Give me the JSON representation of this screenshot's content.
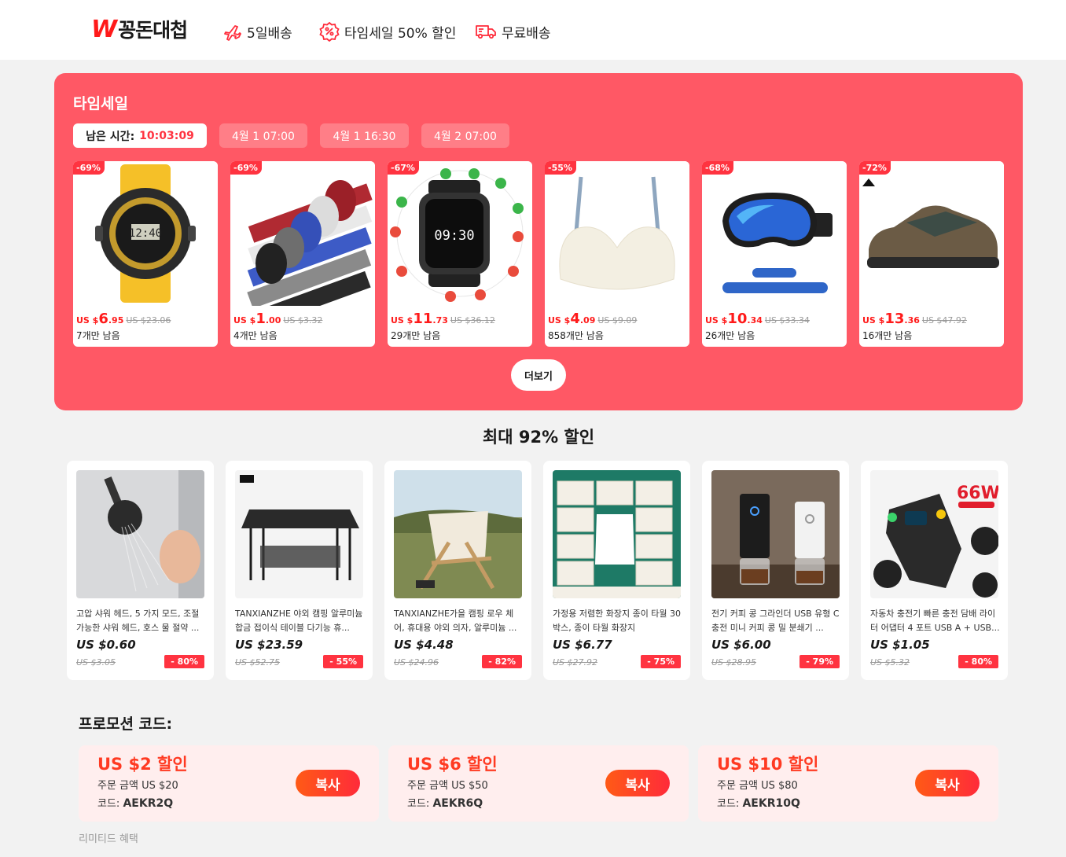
{
  "header": {
    "logo_mark": "W",
    "logo_text": "꽁돈대첩",
    "items": [
      {
        "label": "5일배송",
        "icon": "airplane-icon"
      },
      {
        "label": "타임세일 50% 할인",
        "icon": "discount-icon"
      },
      {
        "label": "무료배송",
        "icon": "truck-icon"
      }
    ]
  },
  "timesale": {
    "title": "타임세일",
    "remaining_label": "남은 시간:",
    "countdown": "10:03:09",
    "tabs": [
      "4월 1 07:00",
      "4월 1 16:30",
      "4월 2 07:00"
    ],
    "more_label": "더보기",
    "products": [
      {
        "discount": "-69%",
        "currency": "US $",
        "int": "6",
        "dec": ".95",
        "orig": "US $23.06",
        "left": "7개만 남음",
        "image": "watch"
      },
      {
        "discount": "-69%",
        "currency": "US $",
        "int": "1",
        "dec": ".00",
        "orig": "US $3.32",
        "left": "4개만 남음",
        "image": "velcro-ties"
      },
      {
        "discount": "-67%",
        "currency": "US $",
        "int": "11",
        "dec": ".73",
        "orig": "US $36.12",
        "left": "29개만 남음",
        "image": "smartwatch"
      },
      {
        "discount": "-55%",
        "currency": "US $",
        "int": "4",
        "dec": ".09",
        "orig": "US $9.09",
        "left": "858개만 남음",
        "image": "bra"
      },
      {
        "discount": "-68%",
        "currency": "US $",
        "int": "10",
        "dec": ".34",
        "orig": "US $33.34",
        "left": "26개만 남음",
        "image": "ski-goggles"
      },
      {
        "discount": "-72%",
        "currency": "US $",
        "int": "13",
        "dec": ".36",
        "orig": "US $47.92",
        "left": "16개만 남음",
        "image": "hiking-shoe"
      }
    ]
  },
  "max_discount": {
    "title": "최대 92% 할인",
    "products": [
      {
        "name": "고압 샤워 헤드, 5 가지 모드, 조절 가능한 샤워 헤드, 호스 물 절약 ...",
        "price": "US $0.60",
        "orig": "US $3.05",
        "off": "- 80%",
        "image": "shower-head"
      },
      {
        "name": "TANXIANZHE 야외 캠핑 알루미늄 합금 접이식 테이블 다기능 휴...",
        "price": "US $23.59",
        "orig": "US $52.75",
        "off": "- 55%",
        "image": "camp-table"
      },
      {
        "name": "TANXIANZHE가을 캠핑 로우 체어, 휴대용 야외 의자, 알루미늄 ...",
        "price": "US $4.48",
        "orig": "US $24.96",
        "off": "- 82%",
        "image": "camp-chair"
      },
      {
        "name": "가정용 저렴한 화장지 종이 타월 30 박스, 종이 타월 화장지",
        "price": "US $6.77",
        "orig": "US $27.92",
        "off": "- 75%",
        "image": "tissue-boxes"
      },
      {
        "name": "전기 커피 콩 그라인더 USB 유형 C 충전 미니 커피 콩 밀 분쇄기 ...",
        "price": "US $6.00",
        "orig": "US $28.95",
        "off": "- 79%",
        "image": "coffee-grinder"
      },
      {
        "name": "자동차 충전기 빠른 충전 담배 라이터 어댑터 4 포트 USB A + USB...",
        "price": "US $1.05",
        "orig": "US $5.32",
        "off": "- 80%",
        "image": "car-charger"
      }
    ]
  },
  "promo": {
    "title": "프로모션 코드:",
    "code_label": "코드:",
    "copy_label": "복사",
    "coupons": [
      {
        "amount": "US $2 할인",
        "min": "주문 금액 US $20",
        "code": "AEKR2Q"
      },
      {
        "amount": "US $6 할인",
        "min": "주문 금액 US $50",
        "code": "AEKR6Q"
      },
      {
        "amount": "US $10 할인",
        "min": "주문 금액 US $80",
        "code": "AEKR10Q"
      }
    ],
    "footnote": "리미티드 혜택"
  },
  "colors": {
    "accent": "#ff5865",
    "price_red": "#ff1a1a",
    "badge_red": "#ff3340",
    "coupon_bg": "#ffeeee"
  }
}
